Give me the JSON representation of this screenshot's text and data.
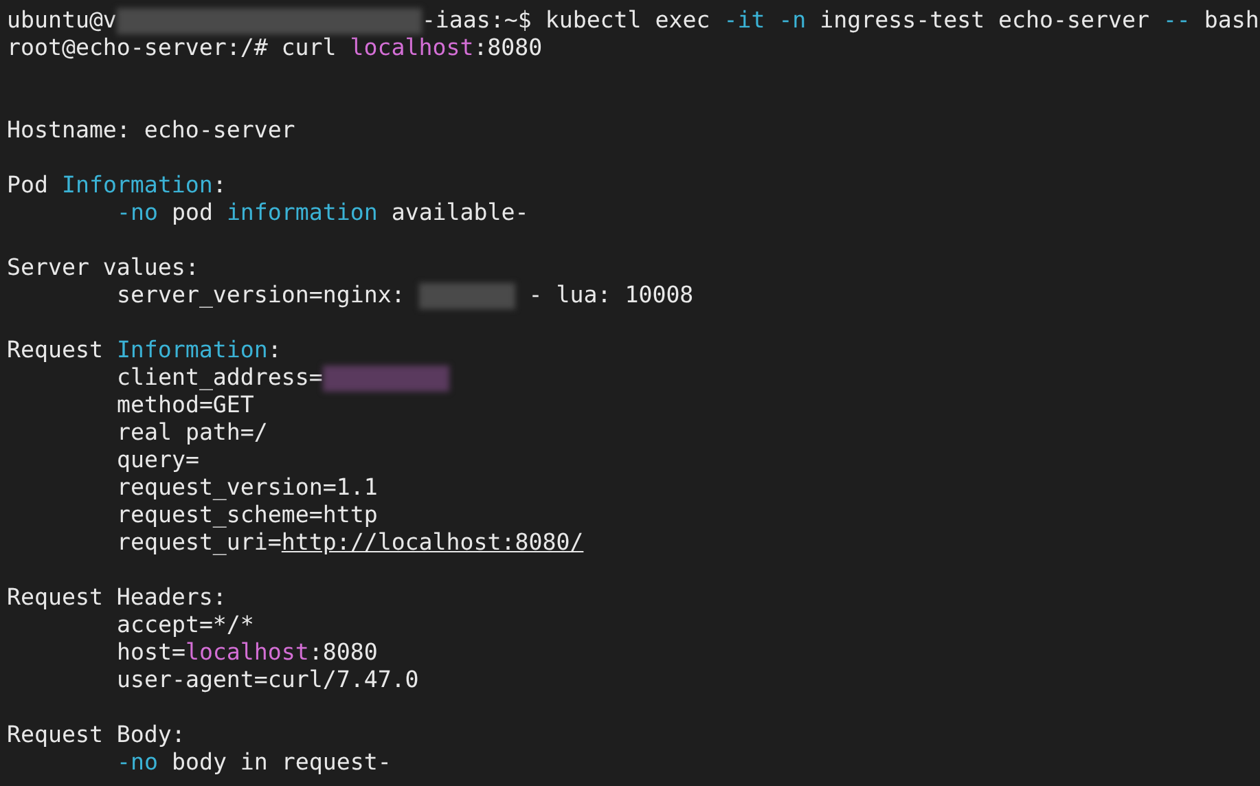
{
  "commands": [
    {
      "segments": [
        {
          "kind": "text",
          "text": "ubuntu@v"
        },
        {
          "kind": "redacted"
        },
        {
          "kind": "text",
          "text": "-iaas:~$ kubectl exec "
        },
        {
          "kind": "keyword",
          "text": "-it -n"
        },
        {
          "kind": "text",
          "text": " ingress-test echo-server "
        },
        {
          "kind": "keyword",
          "text": "--"
        },
        {
          "kind": "text",
          "text": " bash"
        }
      ]
    },
    {
      "segments": [
        {
          "kind": "text",
          "text": "root@echo-server:/# curl "
        },
        {
          "kind": "highlight",
          "text": "localhost"
        },
        {
          "kind": "text",
          "text": ":8080"
        }
      ]
    }
  ],
  "sections": [
    {
      "segments": [
        {
          "kind": "text",
          "text": "Hostname: echo-server"
        }
      ]
    },
    {
      "segments": [
        {
          "kind": "text",
          "text": "Pod "
        },
        {
          "kind": "keyword",
          "text": "Information"
        },
        {
          "kind": "text",
          "text": ":"
        }
      ],
      "children": [
        {
          "segments": [
            {
              "kind": "keyword",
              "text": "-no"
            },
            {
              "kind": "text",
              "text": " pod "
            },
            {
              "kind": "keyword",
              "text": "information"
            },
            {
              "kind": "text",
              "text": " available-"
            }
          ]
        }
      ]
    },
    {
      "segments": [
        {
          "kind": "text",
          "text": "Server values:"
        }
      ],
      "children": [
        {
          "segments": [
            {
              "kind": "text",
              "text": "server_version=nginx: "
            },
            {
              "kind": "redacted"
            },
            {
              "kind": "text",
              "text": " - lua: 10008"
            }
          ]
        }
      ]
    },
    {
      "segments": [
        {
          "kind": "text",
          "text": "Request "
        },
        {
          "kind": "keyword",
          "text": "Information"
        },
        {
          "kind": "text",
          "text": ":"
        }
      ],
      "children": [
        {
          "segments": [
            {
              "kind": "text",
              "text": "client_address="
            },
            {
              "kind": "redactedpink"
            }
          ]
        },
        {
          "segments": [
            {
              "kind": "text",
              "text": "method=GET"
            }
          ]
        },
        {
          "segments": [
            {
              "kind": "text",
              "text": "real path=/"
            }
          ]
        },
        {
          "segments": [
            {
              "kind": "text",
              "text": "query="
            }
          ]
        },
        {
          "segments": [
            {
              "kind": "text",
              "text": "request_version=1.1"
            }
          ]
        },
        {
          "segments": [
            {
              "kind": "text",
              "text": "request_scheme=http"
            }
          ]
        },
        {
          "segments": [
            {
              "kind": "text",
              "text": "request_uri="
            },
            {
              "kind": "link",
              "text": "http://localhost:8080/"
            }
          ]
        }
      ]
    },
    {
      "segments": [
        {
          "kind": "text",
          "text": "Request Headers:"
        }
      ],
      "children": [
        {
          "segments": [
            {
              "kind": "text",
              "text": "accept=*/*"
            }
          ]
        },
        {
          "segments": [
            {
              "kind": "text",
              "text": "host="
            },
            {
              "kind": "highlight",
              "text": "localhost"
            },
            {
              "kind": "text",
              "text": ":8080"
            }
          ]
        },
        {
          "segments": [
            {
              "kind": "text",
              "text": "user-agent=curl/7.47.0"
            }
          ]
        }
      ]
    },
    {
      "segments": [
        {
          "kind": "text",
          "text": "Request Body:"
        }
      ],
      "children": [
        {
          "segments": [
            {
              "kind": "keyword",
              "text": "-no"
            },
            {
              "kind": "text",
              "text": " body in request-"
            }
          ]
        }
      ]
    }
  ]
}
